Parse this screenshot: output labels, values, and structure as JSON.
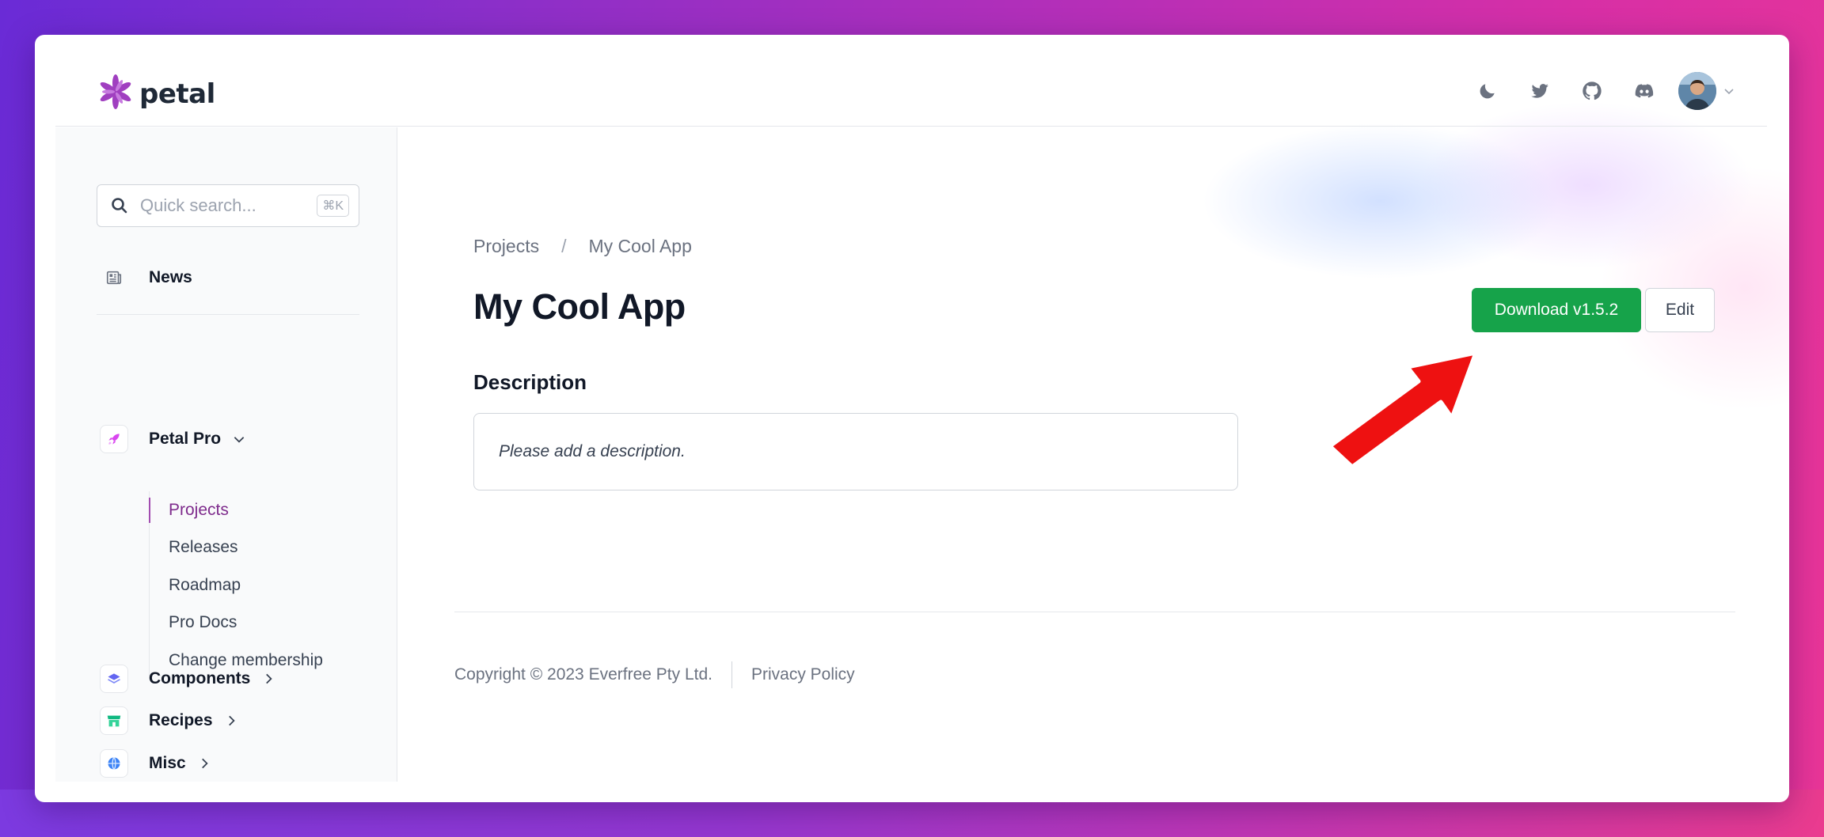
{
  "app": {
    "name": "petal"
  },
  "header": {
    "icons": [
      "moon-icon",
      "twitter-icon",
      "github-icon",
      "discord-icon"
    ]
  },
  "search": {
    "placeholder": "Quick search...",
    "shortcut": "⌘K"
  },
  "sidebar": {
    "news_label": "News",
    "groups": [
      {
        "label": "Petal Pro",
        "icon": "rocket-icon",
        "expanded": true
      },
      {
        "label": "Components",
        "icon": "layers-icon",
        "expanded": false
      },
      {
        "label": "Recipes",
        "icon": "store-icon",
        "expanded": false
      },
      {
        "label": "Misc",
        "icon": "globe-icon",
        "expanded": false
      }
    ],
    "subitems": [
      {
        "label": "Projects",
        "active": true
      },
      {
        "label": "Releases"
      },
      {
        "label": "Roadmap"
      },
      {
        "label": "Pro Docs"
      },
      {
        "label": "Change membership"
      }
    ]
  },
  "breadcrumb": {
    "root": "Projects",
    "separator": "/",
    "current": "My Cool App"
  },
  "page": {
    "title": "My Cool App",
    "download_label": "Download v1.5.2",
    "edit_label": "Edit",
    "description_heading": "Description",
    "description_text": "Please add a description."
  },
  "footer": {
    "copyright": "Copyright © 2023 Everfree Pty Ltd.",
    "privacy": "Privacy Policy"
  },
  "colors": {
    "brand": "#a24db0",
    "download": "#16a34a",
    "arrow": "#ee1111"
  }
}
